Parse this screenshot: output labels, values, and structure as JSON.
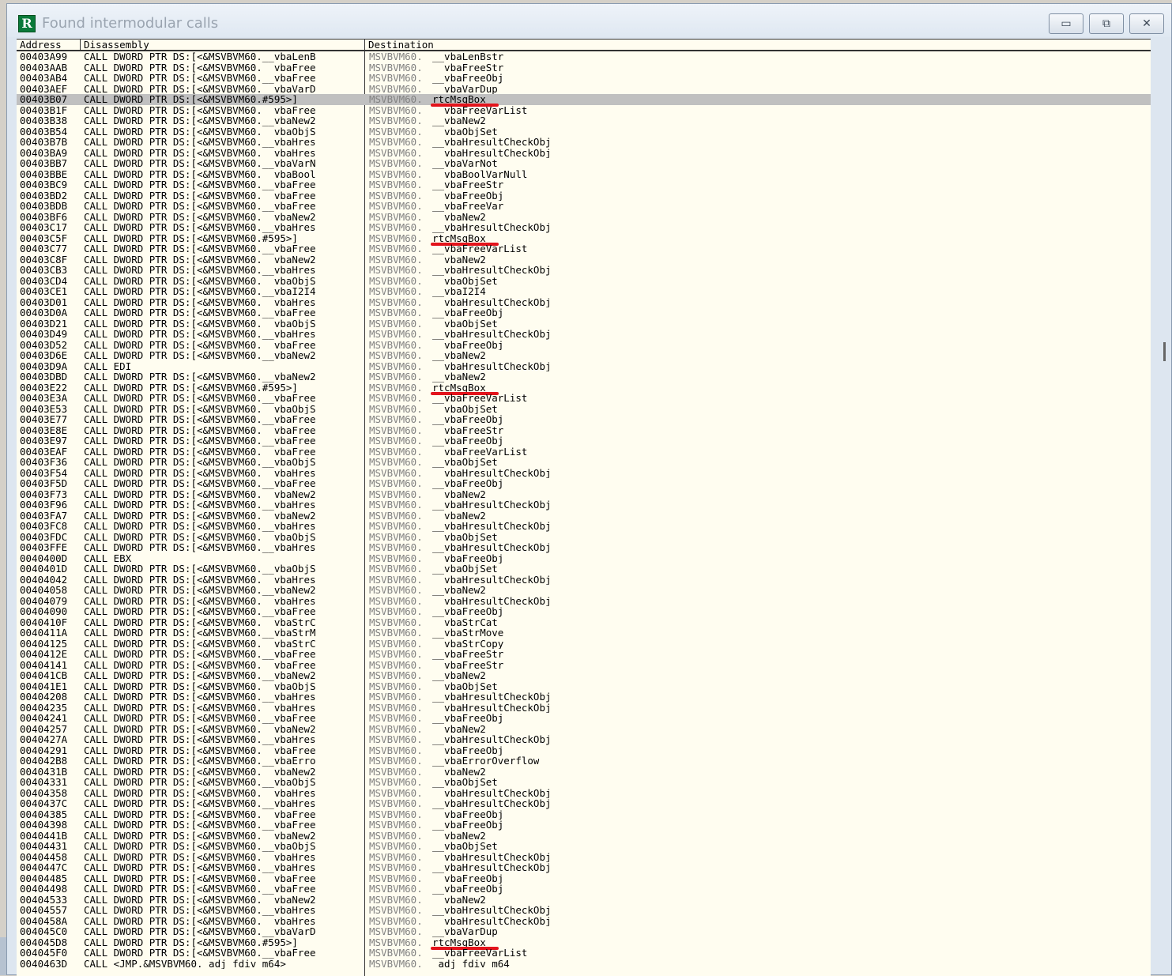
{
  "window": {
    "title": "Found intermodular calls",
    "app_icon_letter": "R",
    "buttons": {
      "minimize": "▭",
      "restore": "⧉",
      "close": "✕"
    }
  },
  "columns": {
    "address": "Address",
    "disassembly": "Disassembly",
    "destination": "Destination"
  },
  "selected_row": 4,
  "marked_rows": [
    4,
    17,
    31,
    83
  ],
  "rows": [
    [
      "00403A99",
      "CALL DWORD PTR DS:[<&MSVBVM60.__vbaLenB",
      "MSVBVM60.",
      "__vbaLenBstr"
    ],
    [
      "00403AAB",
      "CALL DWORD PTR DS:[<&MSVBVM60.__vbaFree",
      "MSVBVM60.",
      "__vbaFreeStr"
    ],
    [
      "00403AB4",
      "CALL DWORD PTR DS:[<&MSVBVM60.__vbaFree",
      "MSVBVM60.",
      "__vbaFreeObj"
    ],
    [
      "00403AEF",
      "CALL DWORD PTR DS:[<&MSVBVM60.__vbaVarD",
      "MSVBVM60.",
      "__vbaVarDup"
    ],
    [
      "00403B07",
      "CALL DWORD PTR DS:[<&MSVBVM60.#595>]",
      "MSVBVM60.",
      "rtcMsgBox"
    ],
    [
      "00403B1F",
      "CALL DWORD PTR DS:[<&MSVBVM60.__vbaFree",
      "MSVBVM60.",
      "__vbaFreeVarList"
    ],
    [
      "00403B38",
      "CALL DWORD PTR DS:[<&MSVBVM60.__vbaNew2",
      "MSVBVM60.",
      "__vbaNew2"
    ],
    [
      "00403B54",
      "CALL DWORD PTR DS:[<&MSVBVM60.__vbaObjS",
      "MSVBVM60.",
      "__vbaObjSet"
    ],
    [
      "00403B7B",
      "CALL DWORD PTR DS:[<&MSVBVM60.__vbaHres",
      "MSVBVM60.",
      "__vbaHresultCheckObj"
    ],
    [
      "00403BA9",
      "CALL DWORD PTR DS:[<&MSVBVM60.__vbaHres",
      "MSVBVM60.",
      "__vbaHresultCheckObj"
    ],
    [
      "00403BB7",
      "CALL DWORD PTR DS:[<&MSVBVM60.__vbaVarN",
      "MSVBVM60.",
      "__vbaVarNot"
    ],
    [
      "00403BBE",
      "CALL DWORD PTR DS:[<&MSVBVM60.__vbaBool",
      "MSVBVM60.",
      "__vbaBoolVarNull"
    ],
    [
      "00403BC9",
      "CALL DWORD PTR DS:[<&MSVBVM60.__vbaFree",
      "MSVBVM60.",
      "__vbaFreeStr"
    ],
    [
      "00403BD2",
      "CALL DWORD PTR DS:[<&MSVBVM60.__vbaFree",
      "MSVBVM60.",
      "__vbaFreeObj"
    ],
    [
      "00403BDB",
      "CALL DWORD PTR DS:[<&MSVBVM60.__vbaFree",
      "MSVBVM60.",
      "__vbaFreeVar"
    ],
    [
      "00403BF6",
      "CALL DWORD PTR DS:[<&MSVBVM60.__vbaNew2",
      "MSVBVM60.",
      "__vbaNew2"
    ],
    [
      "00403C17",
      "CALL DWORD PTR DS:[<&MSVBVM60.__vbaHres",
      "MSVBVM60.",
      "__vbaHresultCheckObj"
    ],
    [
      "00403C5F",
      "CALL DWORD PTR DS:[<&MSVBVM60.#595>]",
      "MSVBVM60.",
      "rtcMsgBox"
    ],
    [
      "00403C77",
      "CALL DWORD PTR DS:[<&MSVBVM60.__vbaFree",
      "MSVBVM60.",
      "__vbaFreeVarList"
    ],
    [
      "00403C8F",
      "CALL DWORD PTR DS:[<&MSVBVM60.__vbaNew2",
      "MSVBVM60.",
      "__vbaNew2"
    ],
    [
      "00403CB3",
      "CALL DWORD PTR DS:[<&MSVBVM60.__vbaHres",
      "MSVBVM60.",
      "__vbaHresultCheckObj"
    ],
    [
      "00403CD4",
      "CALL DWORD PTR DS:[<&MSVBVM60.__vbaObjS",
      "MSVBVM60.",
      "__vbaObjSet"
    ],
    [
      "00403CE1",
      "CALL DWORD PTR DS:[<&MSVBVM60.__vbaI2I4",
      "MSVBVM60.",
      "__vbaI2I4"
    ],
    [
      "00403D01",
      "CALL DWORD PTR DS:[<&MSVBVM60.__vbaHres",
      "MSVBVM60.",
      "__vbaHresultCheckObj"
    ],
    [
      "00403D0A",
      "CALL DWORD PTR DS:[<&MSVBVM60.__vbaFree",
      "MSVBVM60.",
      "__vbaFreeObj"
    ],
    [
      "00403D21",
      "CALL DWORD PTR DS:[<&MSVBVM60.__vbaObjS",
      "MSVBVM60.",
      "__vbaObjSet"
    ],
    [
      "00403D49",
      "CALL DWORD PTR DS:[<&MSVBVM60.__vbaHres",
      "MSVBVM60.",
      "__vbaHresultCheckObj"
    ],
    [
      "00403D52",
      "CALL DWORD PTR DS:[<&MSVBVM60.__vbaFree",
      "MSVBVM60.",
      "__vbaFreeObj"
    ],
    [
      "00403D6E",
      "CALL DWORD PTR DS:[<&MSVBVM60.__vbaNew2",
      "MSVBVM60.",
      "__vbaNew2"
    ],
    [
      "00403D9A",
      "CALL EDI",
      "MSVBVM60.",
      "__vbaHresultCheckObj"
    ],
    [
      "00403DBD",
      "CALL DWORD PTR DS:[<&MSVBVM60.__vbaNew2",
      "MSVBVM60.",
      "__vbaNew2"
    ],
    [
      "00403E22",
      "CALL DWORD PTR DS:[<&MSVBVM60.#595>]",
      "MSVBVM60.",
      "rtcMsgBox"
    ],
    [
      "00403E3A",
      "CALL DWORD PTR DS:[<&MSVBVM60.__vbaFree",
      "MSVBVM60.",
      "__vbaFreeVarList"
    ],
    [
      "00403E53",
      "CALL DWORD PTR DS:[<&MSVBVM60.__vbaObjS",
      "MSVBVM60.",
      "__vbaObjSet"
    ],
    [
      "00403E77",
      "CALL DWORD PTR DS:[<&MSVBVM60.__vbaFree",
      "MSVBVM60.",
      "__vbaFreeObj"
    ],
    [
      "00403E8E",
      "CALL DWORD PTR DS:[<&MSVBVM60.__vbaFree",
      "MSVBVM60.",
      "__vbaFreeStr"
    ],
    [
      "00403E97",
      "CALL DWORD PTR DS:[<&MSVBVM60.__vbaFree",
      "MSVBVM60.",
      "__vbaFreeObj"
    ],
    [
      "00403EAF",
      "CALL DWORD PTR DS:[<&MSVBVM60.__vbaFree",
      "MSVBVM60.",
      "__vbaFreeVarList"
    ],
    [
      "00403F36",
      "CALL DWORD PTR DS:[<&MSVBVM60.__vbaObjS",
      "MSVBVM60.",
      "__vbaObjSet"
    ],
    [
      "00403F54",
      "CALL DWORD PTR DS:[<&MSVBVM60.__vbaHres",
      "MSVBVM60.",
      "__vbaHresultCheckObj"
    ],
    [
      "00403F5D",
      "CALL DWORD PTR DS:[<&MSVBVM60.__vbaFree",
      "MSVBVM60.",
      "__vbaFreeObj"
    ],
    [
      "00403F73",
      "CALL DWORD PTR DS:[<&MSVBVM60.__vbaNew2",
      "MSVBVM60.",
      "__vbaNew2"
    ],
    [
      "00403F96",
      "CALL DWORD PTR DS:[<&MSVBVM60.__vbaHres",
      "MSVBVM60.",
      "__vbaHresultCheckObj"
    ],
    [
      "00403FA7",
      "CALL DWORD PTR DS:[<&MSVBVM60.__vbaNew2",
      "MSVBVM60.",
      "__vbaNew2"
    ],
    [
      "00403FC8",
      "CALL DWORD PTR DS:[<&MSVBVM60.__vbaHres",
      "MSVBVM60.",
      "__vbaHresultCheckObj"
    ],
    [
      "00403FDC",
      "CALL DWORD PTR DS:[<&MSVBVM60.__vbaObjS",
      "MSVBVM60.",
      "__vbaObjSet"
    ],
    [
      "00403FFE",
      "CALL DWORD PTR DS:[<&MSVBVM60.__vbaHres",
      "MSVBVM60.",
      "__vbaHresultCheckObj"
    ],
    [
      "0040400D",
      "CALL EBX",
      "MSVBVM60.",
      "__vbaFreeObj"
    ],
    [
      "0040401D",
      "CALL DWORD PTR DS:[<&MSVBVM60.__vbaObjS",
      "MSVBVM60.",
      "__vbaObjSet"
    ],
    [
      "00404042",
      "CALL DWORD PTR DS:[<&MSVBVM60.__vbaHres",
      "MSVBVM60.",
      "__vbaHresultCheckObj"
    ],
    [
      "00404058",
      "CALL DWORD PTR DS:[<&MSVBVM60.__vbaNew2",
      "MSVBVM60.",
      "__vbaNew2"
    ],
    [
      "00404079",
      "CALL DWORD PTR DS:[<&MSVBVM60.__vbaHres",
      "MSVBVM60.",
      "__vbaHresultCheckObj"
    ],
    [
      "00404090",
      "CALL DWORD PTR DS:[<&MSVBVM60.__vbaFree",
      "MSVBVM60.",
      "__vbaFreeObj"
    ],
    [
      "0040410F",
      "CALL DWORD PTR DS:[<&MSVBVM60.__vbaStrC",
      "MSVBVM60.",
      "__vbaStrCat"
    ],
    [
      "0040411A",
      "CALL DWORD PTR DS:[<&MSVBVM60.__vbaStrM",
      "MSVBVM60.",
      "__vbaStrMove"
    ],
    [
      "00404125",
      "CALL DWORD PTR DS:[<&MSVBVM60.__vbaStrC",
      "MSVBVM60.",
      "__vbaStrCopy"
    ],
    [
      "0040412E",
      "CALL DWORD PTR DS:[<&MSVBVM60.__vbaFree",
      "MSVBVM60.",
      "__vbaFreeStr"
    ],
    [
      "00404141",
      "CALL DWORD PTR DS:[<&MSVBVM60.__vbaFree",
      "MSVBVM60.",
      "__vbaFreeStr"
    ],
    [
      "004041CB",
      "CALL DWORD PTR DS:[<&MSVBVM60.__vbaNew2",
      "MSVBVM60.",
      "__vbaNew2"
    ],
    [
      "004041E1",
      "CALL DWORD PTR DS:[<&MSVBVM60.__vbaObjS",
      "MSVBVM60.",
      "__vbaObjSet"
    ],
    [
      "00404208",
      "CALL DWORD PTR DS:[<&MSVBVM60.__vbaHres",
      "MSVBVM60.",
      "__vbaHresultCheckObj"
    ],
    [
      "00404235",
      "CALL DWORD PTR DS:[<&MSVBVM60.__vbaHres",
      "MSVBVM60.",
      "__vbaHresultCheckObj"
    ],
    [
      "00404241",
      "CALL DWORD PTR DS:[<&MSVBVM60.__vbaFree",
      "MSVBVM60.",
      "__vbaFreeObj"
    ],
    [
      "00404257",
      "CALL DWORD PTR DS:[<&MSVBVM60.__vbaNew2",
      "MSVBVM60.",
      "__vbaNew2"
    ],
    [
      "0040427A",
      "CALL DWORD PTR DS:[<&MSVBVM60.__vbaHres",
      "MSVBVM60.",
      "__vbaHresultCheckObj"
    ],
    [
      "00404291",
      "CALL DWORD PTR DS:[<&MSVBVM60.__vbaFree",
      "MSVBVM60.",
      "__vbaFreeObj"
    ],
    [
      "004042B8",
      "CALL DWORD PTR DS:[<&MSVBVM60.__vbaErro",
      "MSVBVM60.",
      "__vbaErrorOverflow"
    ],
    [
      "0040431B",
      "CALL DWORD PTR DS:[<&MSVBVM60.__vbaNew2",
      "MSVBVM60.",
      "__vbaNew2"
    ],
    [
      "00404331",
      "CALL DWORD PTR DS:[<&MSVBVM60.__vbaObjS",
      "MSVBVM60.",
      "__vbaObjSet"
    ],
    [
      "00404358",
      "CALL DWORD PTR DS:[<&MSVBVM60.__vbaHres",
      "MSVBVM60.",
      "__vbaHresultCheckObj"
    ],
    [
      "0040437C",
      "CALL DWORD PTR DS:[<&MSVBVM60.__vbaHres",
      "MSVBVM60.",
      "__vbaHresultCheckObj"
    ],
    [
      "00404385",
      "CALL DWORD PTR DS:[<&MSVBVM60.__vbaFree",
      "MSVBVM60.",
      "__vbaFreeObj"
    ],
    [
      "00404398",
      "CALL DWORD PTR DS:[<&MSVBVM60.__vbaFree",
      "MSVBVM60.",
      "__vbaFreeObj"
    ],
    [
      "0040441B",
      "CALL DWORD PTR DS:[<&MSVBVM60.__vbaNew2",
      "MSVBVM60.",
      "__vbaNew2"
    ],
    [
      "00404431",
      "CALL DWORD PTR DS:[<&MSVBVM60.__vbaObjS",
      "MSVBVM60.",
      "__vbaObjSet"
    ],
    [
      "00404458",
      "CALL DWORD PTR DS:[<&MSVBVM60.__vbaHres",
      "MSVBVM60.",
      "__vbaHresultCheckObj"
    ],
    [
      "0040447C",
      "CALL DWORD PTR DS:[<&MSVBVM60.__vbaHres",
      "MSVBVM60.",
      "__vbaHresultCheckObj"
    ],
    [
      "00404485",
      "CALL DWORD PTR DS:[<&MSVBVM60.__vbaFree",
      "MSVBVM60.",
      "__vbaFreeObj"
    ],
    [
      "00404498",
      "CALL DWORD PTR DS:[<&MSVBVM60.__vbaFree",
      "MSVBVM60.",
      "__vbaFreeObj"
    ],
    [
      "00404533",
      "CALL DWORD PTR DS:[<&MSVBVM60.__vbaNew2",
      "MSVBVM60.",
      "__vbaNew2"
    ],
    [
      "00404557",
      "CALL DWORD PTR DS:[<&MSVBVM60.__vbaHres",
      "MSVBVM60.",
      "__vbaHresultCheckObj"
    ],
    [
      "0040458A",
      "CALL DWORD PTR DS:[<&MSVBVM60.__vbaHres",
      "MSVBVM60.",
      "__vbaHresultCheckObj"
    ],
    [
      "004045C0",
      "CALL DWORD PTR DS:[<&MSVBVM60.__vbaVarD",
      "MSVBVM60.",
      "__vbaVarDup"
    ],
    [
      "004045D8",
      "CALL DWORD PTR DS:[<&MSVBVM60.#595>]",
      "MSVBVM60.",
      "rtcMsgBox"
    ],
    [
      "004045F0",
      "CALL DWORD PTR DS:[<&MSVBVM60.__vbaFree",
      "MSVBVM60.",
      "__vbaFreeVarList"
    ],
    [
      "0040463D",
      "CALL <JMP.&MSVBVM60._adj_fdiv_m64>",
      "MSVBVM60.",
      "_adj_fdiv_m64"
    ]
  ]
}
